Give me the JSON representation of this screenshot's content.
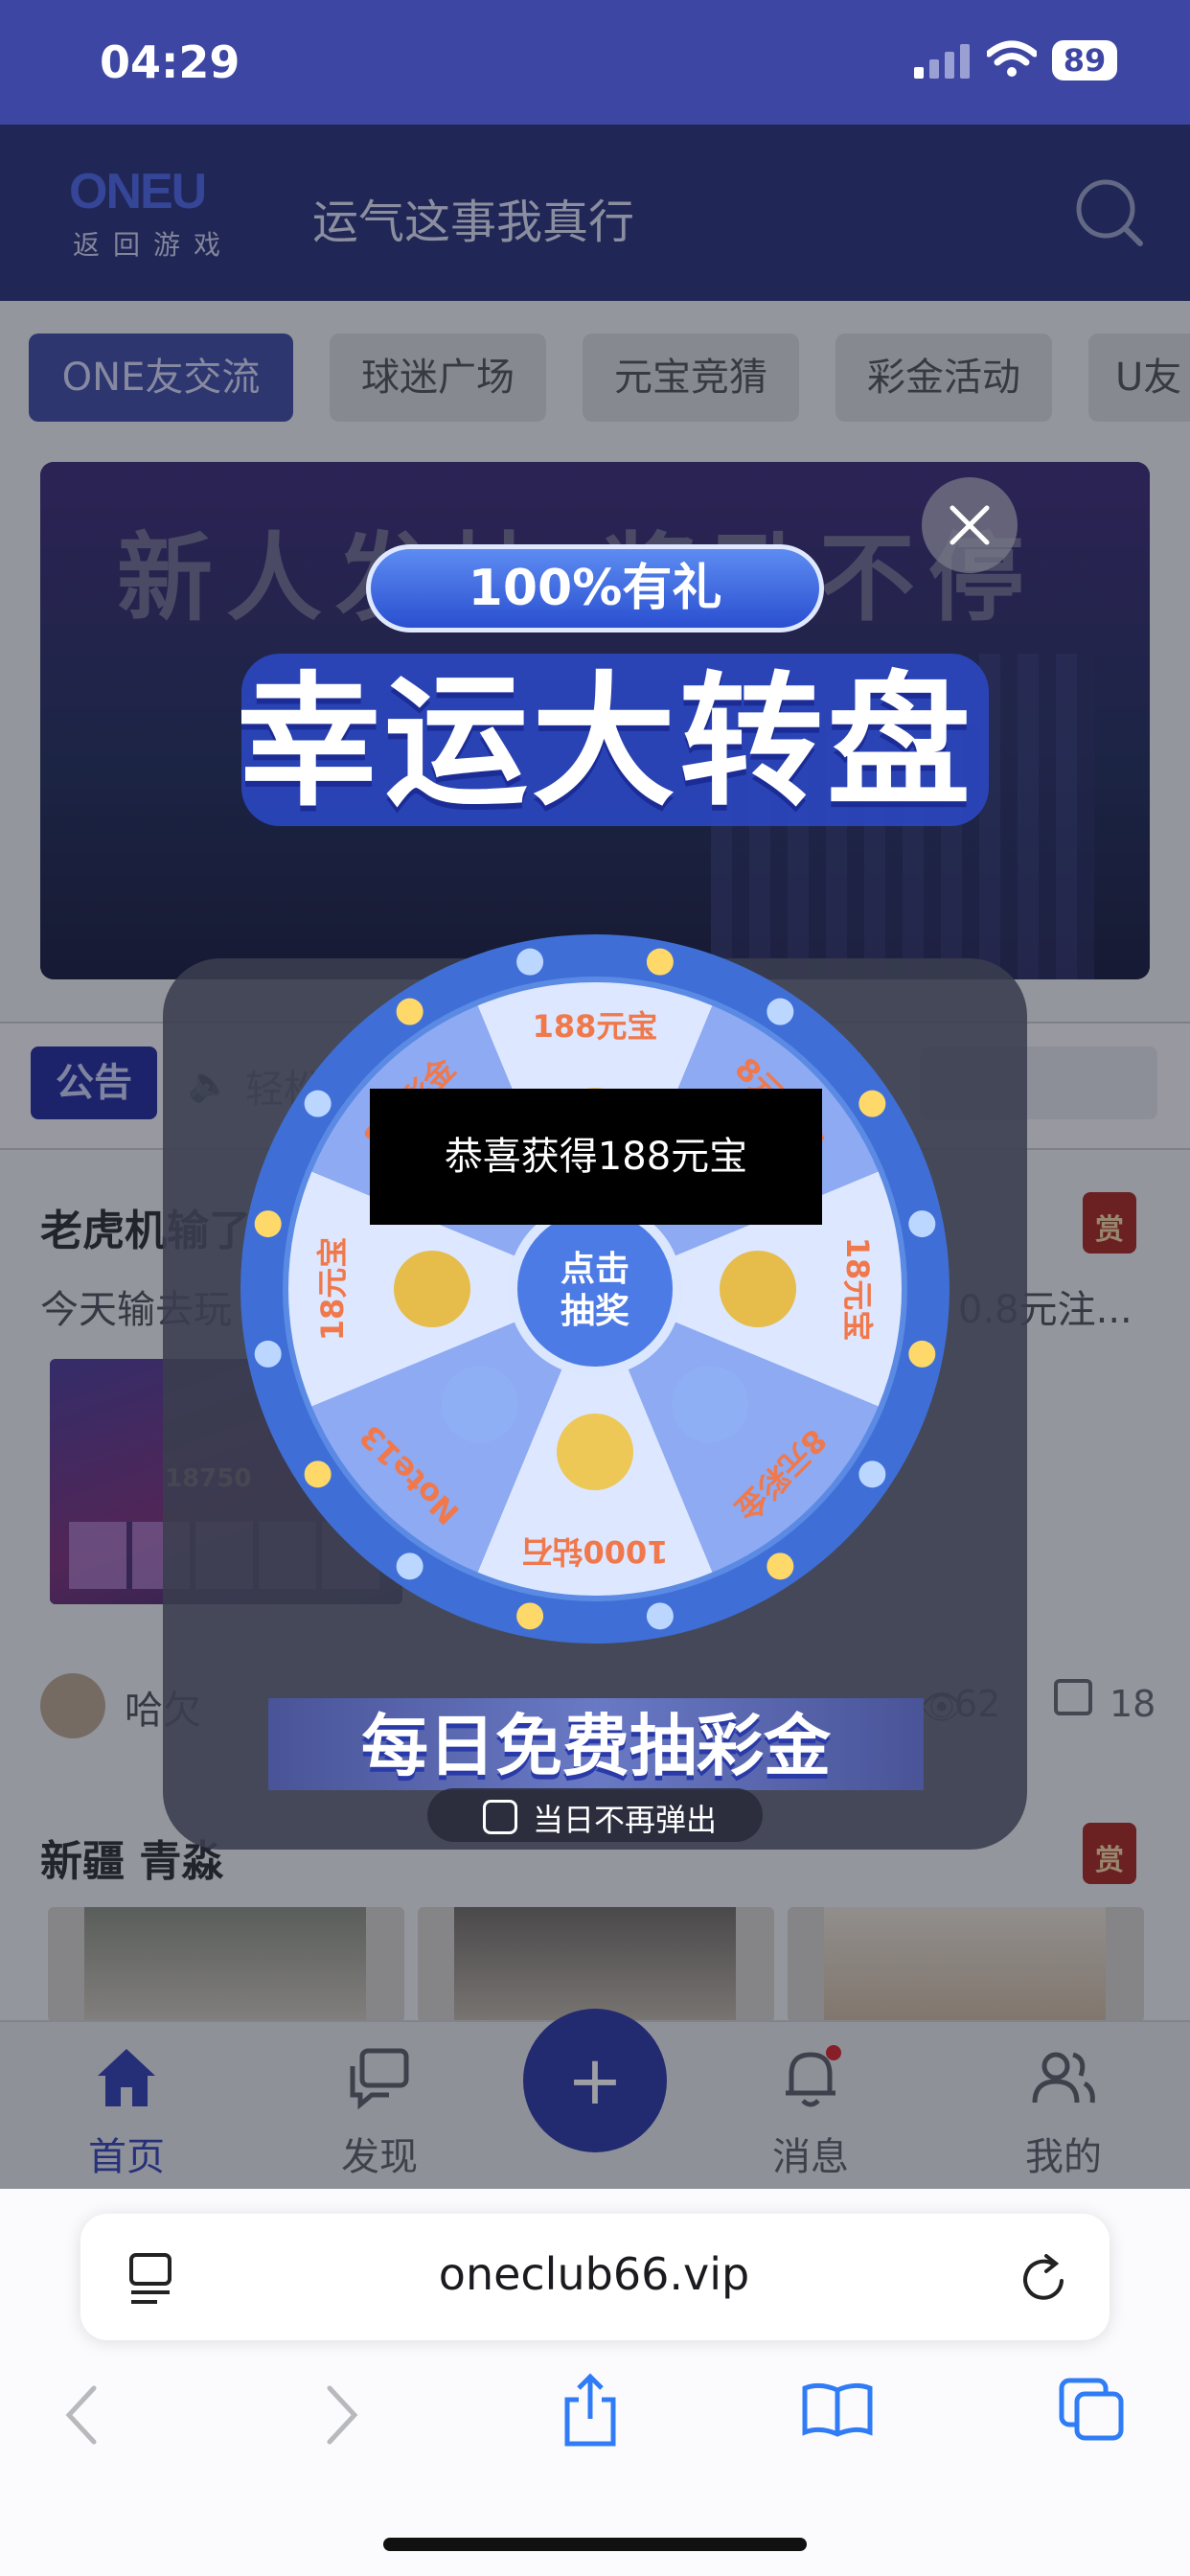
{
  "status_bar": {
    "time": "04:29",
    "battery": "89"
  },
  "header": {
    "logo_text": "ONEU",
    "logo_subtitle": "返回游戏",
    "title": "运气这事我真行"
  },
  "tabs": [
    {
      "label": "ONE友交流",
      "active": true
    },
    {
      "label": "球迷广场",
      "active": false
    },
    {
      "label": "元宝竞猜",
      "active": false
    },
    {
      "label": "彩金活动",
      "active": false
    },
    {
      "label": "U友",
      "active": false
    }
  ],
  "banner": {
    "text": "新人发帖 奖励不停"
  },
  "notice": {
    "badge": "公告",
    "text": "轻松"
  },
  "post1": {
    "title": "老虎机输了",
    "excerpt": "今天输去玩",
    "excerpt_tail": "0.8元注...",
    "reward": "赏",
    "image_caption": "18750",
    "author": "哈欠",
    "views": "62",
    "comments": "18"
  },
  "post2": {
    "title": "新疆 青淼",
    "reward": "赏"
  },
  "bottom_nav": {
    "items": [
      {
        "label": "首页",
        "active": true
      },
      {
        "label": "发现",
        "active": false
      },
      {
        "label": "消息",
        "active": false
      },
      {
        "label": "我的",
        "active": false
      }
    ],
    "add_label": "+"
  },
  "browser": {
    "url": "oneclub66.vip"
  },
  "modal": {
    "tagline": "100%有礼",
    "title": "幸运大转盘",
    "prizes": [
      "188元宝",
      "8元彩金",
      "18元宝",
      "8元彩金",
      "1000钻石",
      "Note13",
      "18元宝",
      "8元彩金"
    ],
    "spin_button": "点击抽奖",
    "spin_button_line1": "点击",
    "spin_button_line2": "抽奖",
    "toast": "恭喜获得188元宝",
    "daily_banner": "每日免费抽彩金",
    "dont_show_label": "当日不再弹出"
  },
  "colors": {
    "header_bg": "#273077",
    "accent": "#3e4aa6",
    "wheel_rim": "#3f6fd6",
    "wheel_slice_a": "#dde7ff",
    "wheel_slice_b": "#8eaaf2",
    "prize_text": "#f0784a"
  }
}
